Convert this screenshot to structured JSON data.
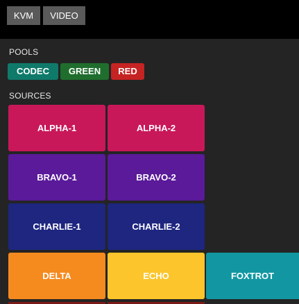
{
  "top_tabs": [
    {
      "label": "KVM"
    },
    {
      "label": "VIDEO"
    }
  ],
  "pools": {
    "heading": "POOLS",
    "items": [
      {
        "label": "CODEC",
        "color": "#0f7a6a"
      },
      {
        "label": "GREEN",
        "color": "#1f6e2e"
      },
      {
        "label": "RED",
        "color": "#c62323"
      }
    ]
  },
  "sources": {
    "heading": "SOURCES",
    "items": [
      {
        "label": "ALPHA-1",
        "color": "#c8185a"
      },
      {
        "label": "ALPHA-2",
        "color": "#c8185a"
      },
      {
        "label": "BRAVO-1",
        "color": "#5a1a9a"
      },
      {
        "label": "BRAVO-2",
        "color": "#5a1a9a"
      },
      {
        "label": "CHARLIE-1",
        "color": "#1e2680"
      },
      {
        "label": "CHARLIE-2",
        "color": "#1e2680"
      },
      {
        "label": "DELTA",
        "color": "#f58a1f"
      },
      {
        "label": "ECHO",
        "color": "#fbc52b"
      },
      {
        "label": "FOXTROT",
        "color": "#1297a2"
      }
    ]
  }
}
